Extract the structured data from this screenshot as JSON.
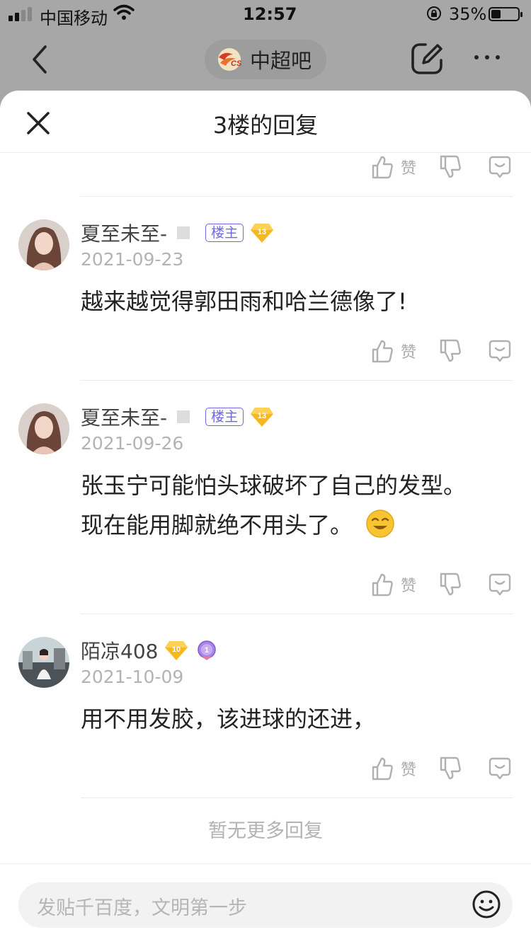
{
  "status": {
    "carrier": "中国移动",
    "time": "12:57",
    "battery": "35%",
    "battery_level": 0.35
  },
  "nav": {
    "forum_name": "中超吧"
  },
  "sheet": {
    "title": "3楼的回复",
    "like_label": "赞",
    "no_more": "暂无更多回复",
    "input_placeholder": "发贴千百度，文明第一步"
  },
  "replies": [
    {
      "username": "夏至未至-",
      "owner_badge": "楼主",
      "level": "13",
      "date": "2021-09-23",
      "text": "越来越觉得郭田雨和哈兰德像了!"
    },
    {
      "username": "夏至未至-",
      "owner_badge": "楼主",
      "level": "13",
      "date": "2021-09-26",
      "text": "张玉宁可能怕头球破坏了自己的发型。现在能用脚就绝不用头了。"
    },
    {
      "username": "陌凉408",
      "level": "10",
      "level2": "1",
      "date": "2021-10-09",
      "text": "用不用发胶，该进球的还进，"
    }
  ],
  "colors": {
    "accent": "#6e67e8",
    "level_gold": "#f5b820",
    "overlay": "#a7a7a7"
  }
}
